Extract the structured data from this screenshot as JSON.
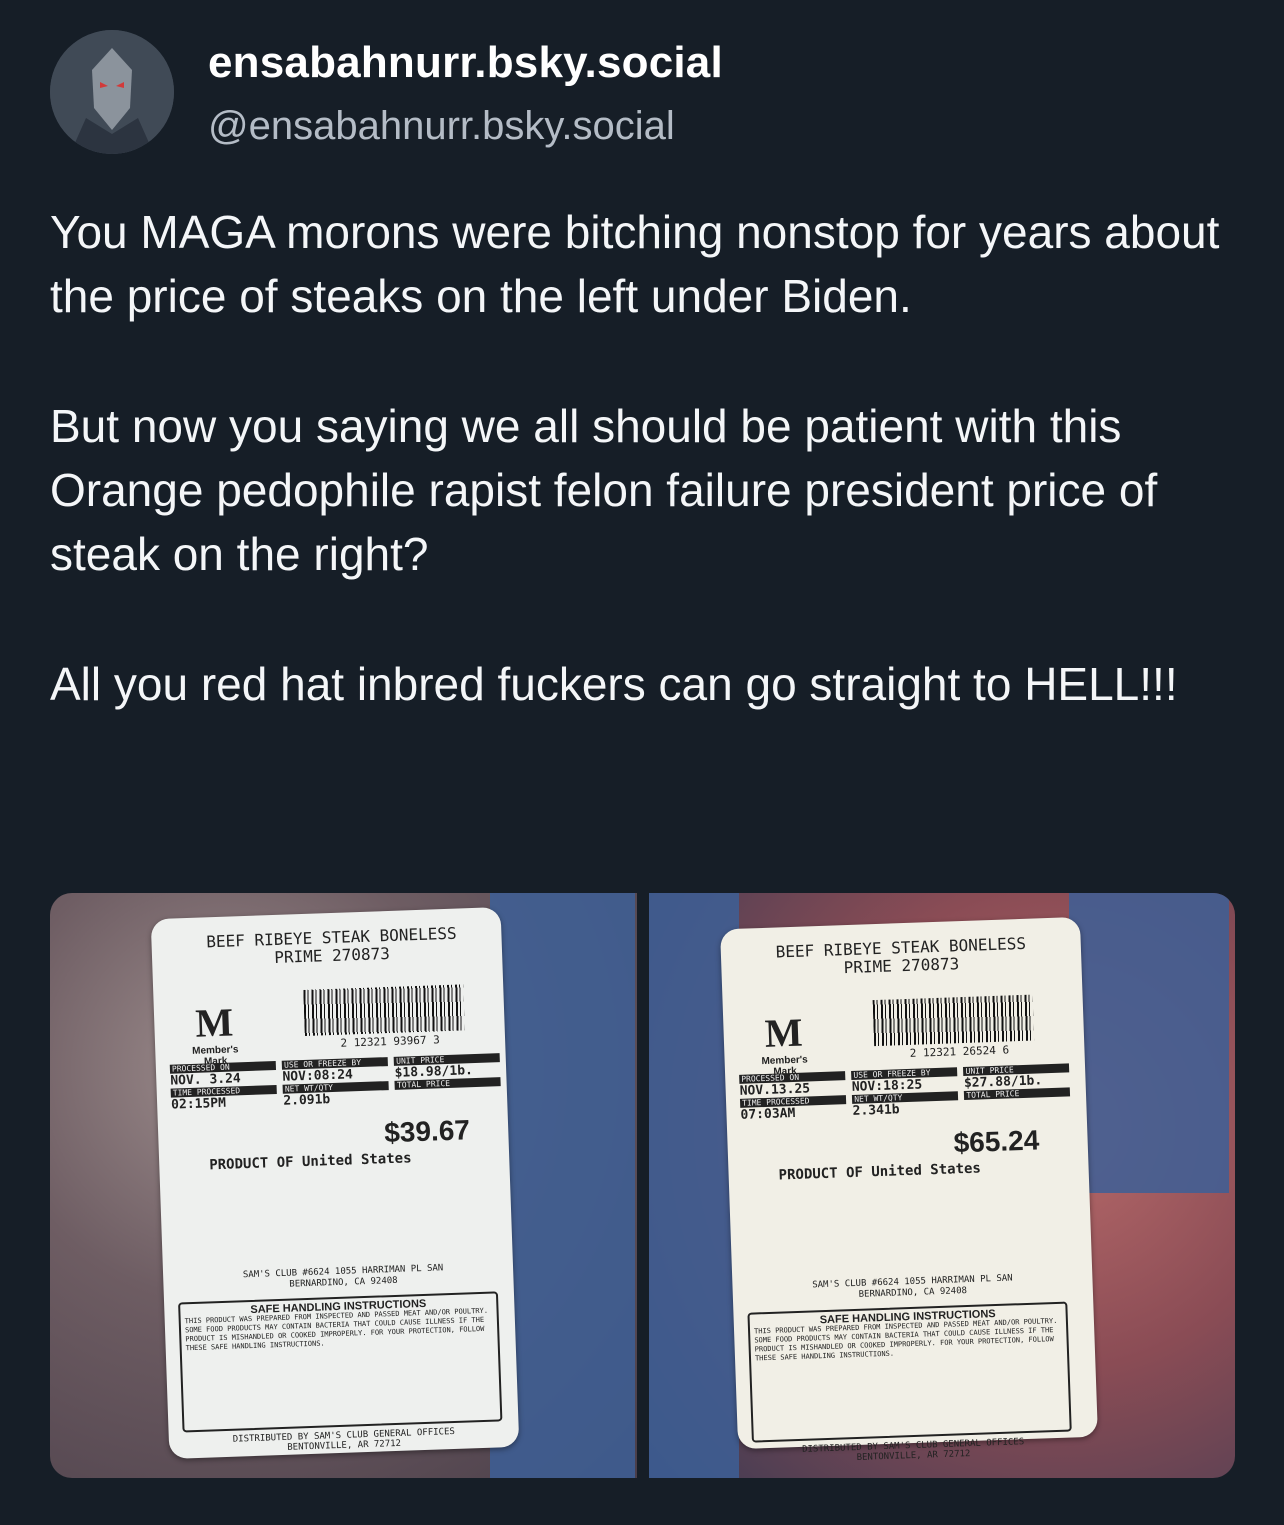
{
  "post": {
    "display_name": "ensabahnurr.bsky.social",
    "handle": "@ensabahnurr.bsky.social",
    "paragraphs": [
      "You MAGA morons were bitching nonstop for years about the price of steaks on the left under Biden.",
      "But now you saying we all should be patient with this Orange pedophile rapist felon failure president price of steak on the right?",
      "All you red hat inbred fuckers can go straight to HELL!!!"
    ]
  },
  "media": {
    "left_label": {
      "title_line1": "BEEF RIBEYE STEAK BONELESS",
      "title_line2": "PRIME 270873",
      "brand": "Member's Mark",
      "barcode_number": "2 12321 93967 3",
      "processed_on_label": "PROCESSED ON",
      "processed_on": "NOV. 3.24",
      "time_processed_label": "TIME PROCESSED",
      "time_processed": "02:15PM",
      "use_by_label": "USE OR FREEZE BY",
      "use_by": "NOV:08:24",
      "net_wt_label": "NET WT/QTY",
      "net_wt": "2.091b",
      "unit_price_label": "UNIT PRICE",
      "unit_price": "$18.98/1b.",
      "total_price_label": "TOTAL PRICE",
      "total_price": "$39.67",
      "origin": "PRODUCT OF United States",
      "store": "SAM'S CLUB #6624 1055 HARRIMAN PL SAN BERNARDINO, CA 92408",
      "safe_title": "SAFE HANDLING INSTRUCTIONS",
      "safe_text": "THIS PRODUCT WAS PREPARED FROM INSPECTED AND PASSED MEAT AND/OR POULTRY. SOME FOOD PRODUCTS MAY CONTAIN BACTERIA THAT COULD CAUSE ILLNESS IF THE PRODUCT IS MISHANDLED OR COOKED IMPROPERLY. FOR YOUR PROTECTION, FOLLOW THESE SAFE HANDLING INSTRUCTIONS.",
      "distributed": "DISTRIBUTED BY SAM'S CLUB GENERAL OFFICES BENTONVILLE, AR 72712"
    },
    "right_label": {
      "title_line1": "BEEF RIBEYE STEAK BONELESS",
      "title_line2": "PRIME 270873",
      "brand": "Member's Mark",
      "barcode_number": "2 12321 26524 6",
      "processed_on_label": "PROCESSED ON",
      "processed_on": "NOV.13.25",
      "time_processed_label": "TIME PROCESSED",
      "time_processed": "07:03AM",
      "use_by_label": "USE OR FREEZE BY",
      "use_by": "NOV:18:25",
      "net_wt_label": "NET WT/QTY",
      "net_wt": "2.341b",
      "unit_price_label": "UNIT PRICE",
      "unit_price": "$27.88/1b.",
      "total_price_label": "TOTAL PRICE",
      "total_price": "$65.24",
      "origin": "PRODUCT OF United States",
      "store": "SAM'S CLUB #6624 1055 HARRIMAN PL SAN BERNARDINO, CA 92408",
      "safe_title": "SAFE HANDLING INSTRUCTIONS",
      "safe_text": "THIS PRODUCT WAS PREPARED FROM INSPECTED AND PASSED MEAT AND/OR POULTRY. SOME FOOD PRODUCTS MAY CONTAIN BACTERIA THAT COULD CAUSE ILLNESS IF THE PRODUCT IS MISHANDLED OR COOKED IMPROPERLY. FOR YOUR PROTECTION, FOLLOW THESE SAFE HANDLING INSTRUCTIONS.",
      "distributed": "DISTRIBUTED BY SAM'S CLUB GENERAL OFFICES BENTONVILLE, AR 72712"
    }
  }
}
